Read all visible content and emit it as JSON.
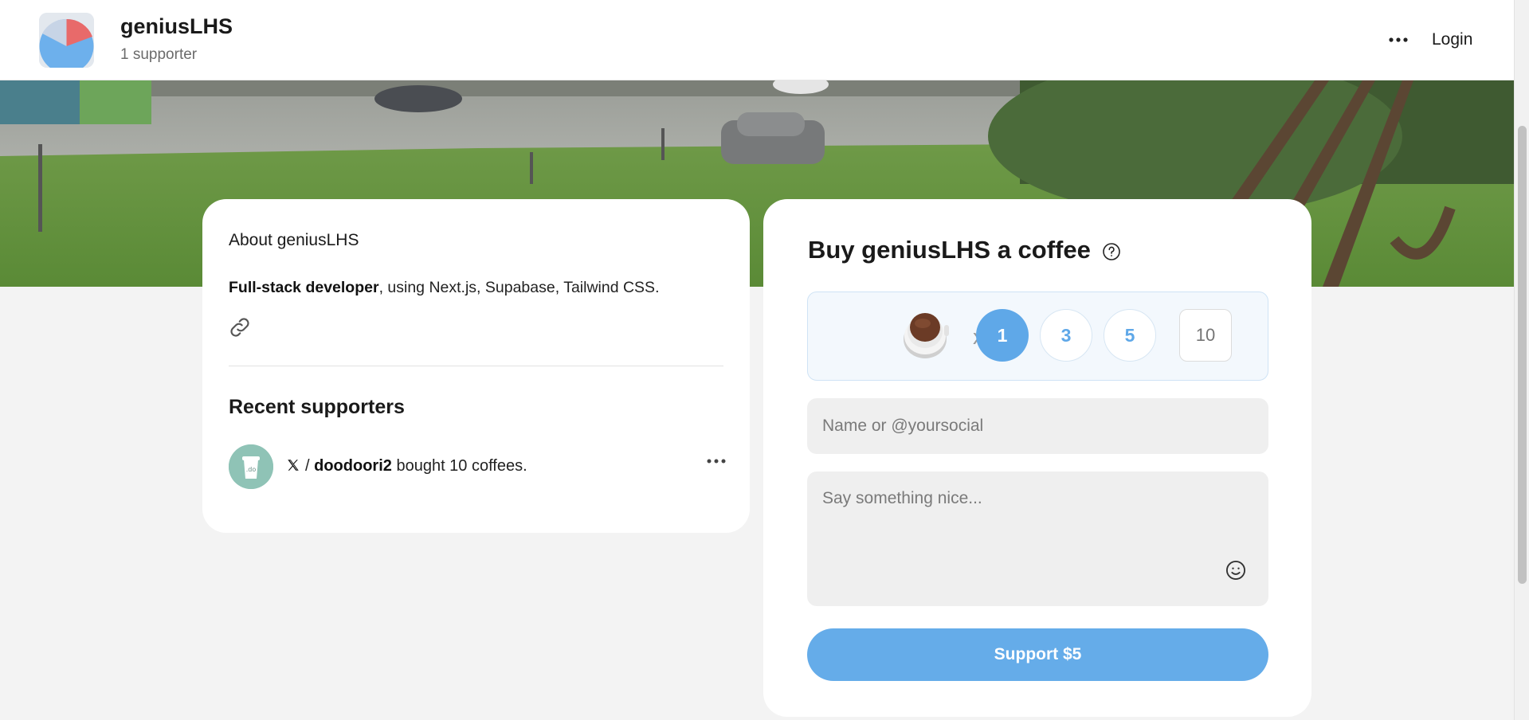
{
  "header": {
    "creator_name": "geniusLHS",
    "supporter_count": "1 supporter",
    "more_icon": "ellipsis-icon",
    "login_label": "Login"
  },
  "about": {
    "title": "About geniusLHS",
    "desc_bold": "Full-stack developer",
    "desc_rest": ", using Next.js, Supabase, Tailwind CSS.",
    "link_icon": "link-icon"
  },
  "recent": {
    "title": "Recent supporters",
    "items": [
      {
        "platform_icon": "x-logo-icon",
        "prefix": "/ ",
        "name": "doodoori2",
        "action": " bought 10 coffees."
      }
    ]
  },
  "buy": {
    "title": "Buy geniusLHS a coffee",
    "multiplier": "x",
    "quantities": [
      "1",
      "3",
      "5"
    ],
    "selected_quantity": "1",
    "custom_quantity_placeholder": "10",
    "name_placeholder": "Name or @yoursocial",
    "message_placeholder": "Say something nice...",
    "support_label": "Support $5"
  },
  "colors": {
    "accent": "#5fa8e8",
    "button": "#65ace9",
    "background": "#f3f3f3"
  }
}
